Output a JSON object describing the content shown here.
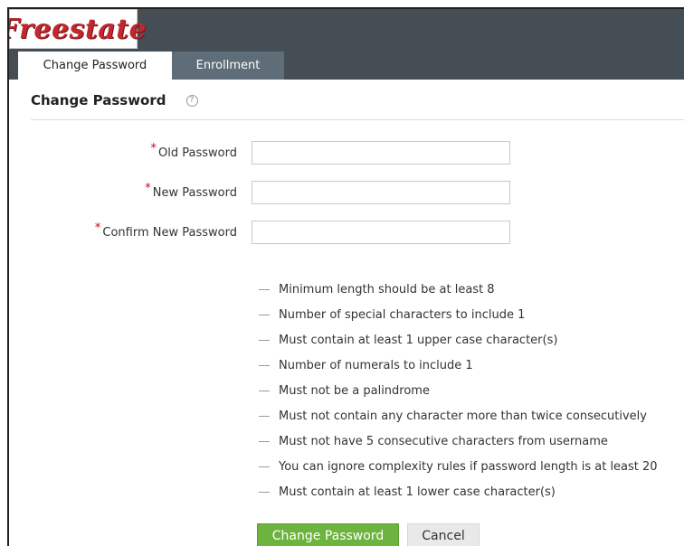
{
  "brand": {
    "logo_text": "Freestate",
    "logo_color": "#c0282d"
  },
  "tabs": [
    {
      "label": "Change Password",
      "active": true
    },
    {
      "label": "Enrollment",
      "active": false
    }
  ],
  "page": {
    "title": "Change Password",
    "help_icon": "question-circle-icon"
  },
  "form": {
    "required_marker": "*",
    "fields": [
      {
        "label": "Old Password",
        "value": "",
        "placeholder": ""
      },
      {
        "label": "New Password",
        "value": "",
        "placeholder": ""
      },
      {
        "label": "Confirm New Password",
        "value": "",
        "placeholder": ""
      }
    ]
  },
  "rules": [
    "Minimum length should be at least 8",
    "Number of special characters to include 1",
    "Must contain at least 1 upper case character(s)",
    "Number of numerals to include 1",
    "Must not be a palindrome",
    "Must not contain any character more than twice consecutively",
    "Must not have 5 consecutive characters from username",
    "You can ignore complexity rules if password length is at least 20",
    "Must contain at least 1 lower case character(s)"
  ],
  "buttons": {
    "submit_label": "Change Password",
    "cancel_label": "Cancel"
  },
  "colors": {
    "header_bg": "#454e55",
    "inactive_tab": "#5e6d78",
    "primary_button": "#6db33f",
    "required": "#d0021b"
  }
}
